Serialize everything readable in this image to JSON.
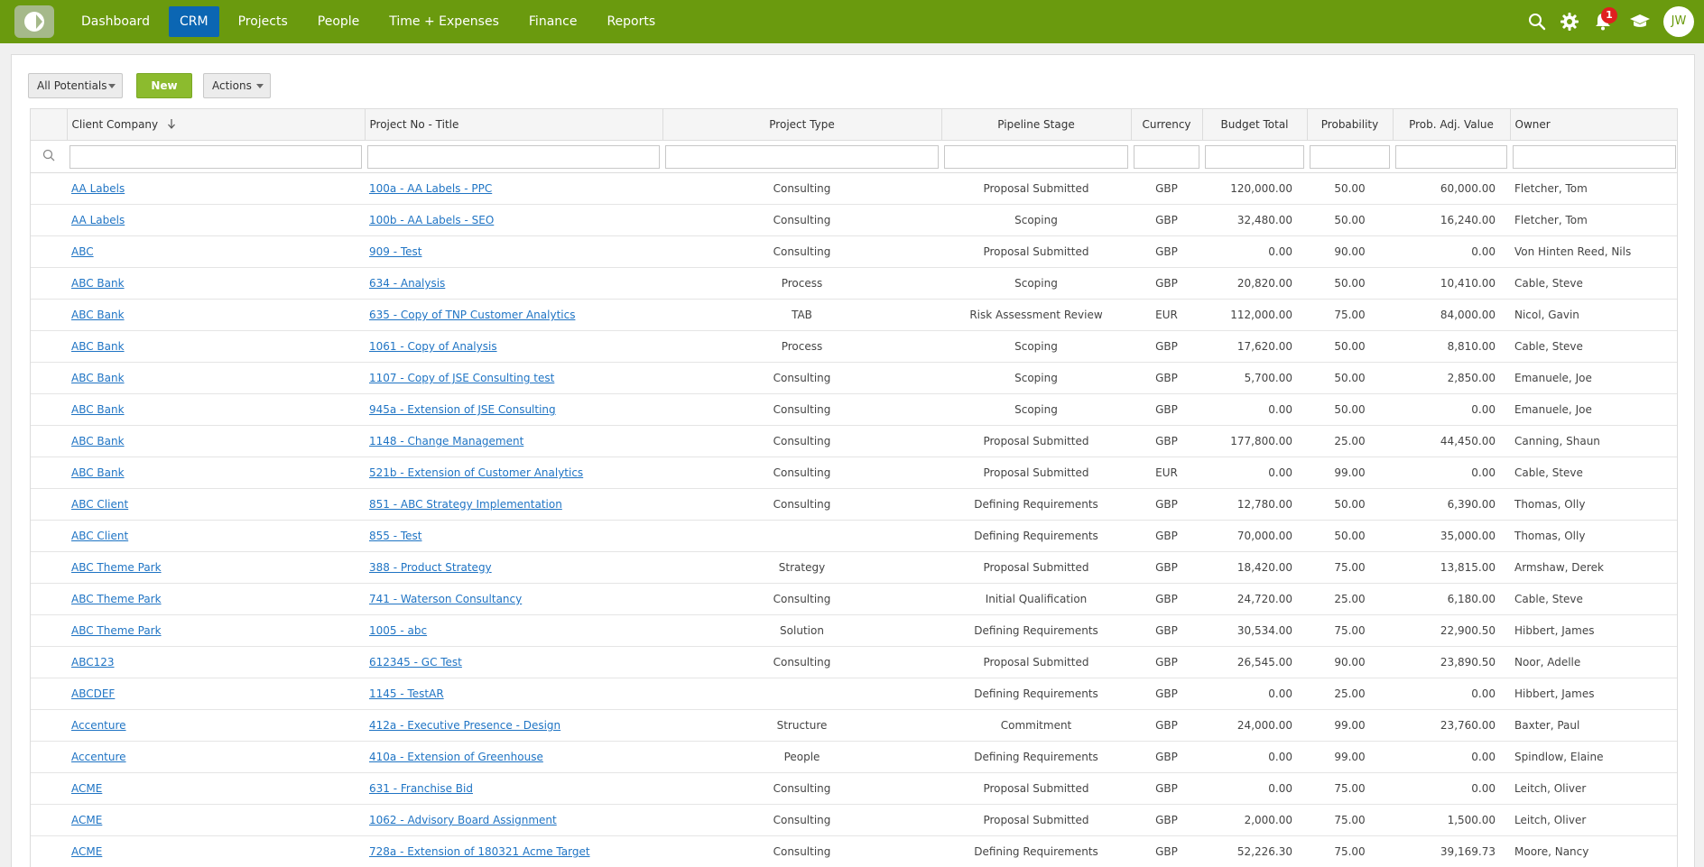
{
  "nav": {
    "items": [
      "Dashboard",
      "CRM",
      "Projects",
      "People",
      "Time + Expenses",
      "Finance",
      "Reports"
    ],
    "active": "CRM",
    "notification_count": "1",
    "avatar_initials": "JW",
    "brand_color": "#6a9a0e",
    "active_color": "#0b66b3"
  },
  "toolbar": {
    "filter_label": "All Potentials",
    "new_label": "New",
    "actions_label": "Actions"
  },
  "table": {
    "columns": [
      "Client Company",
      "Project No - Title",
      "Project Type",
      "Pipeline Stage",
      "Currency",
      "Budget Total",
      "Probability",
      "Prob. Adj. Value",
      "Owner"
    ],
    "rows": [
      [
        "AA Labels",
        "100a - AA Labels - PPC",
        "Consulting",
        "Proposal Submitted",
        "GBP",
        "120,000.00",
        "50.00",
        "60,000.00",
        "Fletcher, Tom"
      ],
      [
        "AA Labels",
        "100b - AA Labels - SEO",
        "Consulting",
        "Scoping",
        "GBP",
        "32,480.00",
        "50.00",
        "16,240.00",
        "Fletcher, Tom"
      ],
      [
        "ABC",
        "909 - Test",
        "Consulting",
        "Proposal Submitted",
        "GBP",
        "0.00",
        "90.00",
        "0.00",
        "Von Hinten Reed, Nils"
      ],
      [
        "ABC Bank",
        "634 - Analysis",
        "Process",
        "Scoping",
        "GBP",
        "20,820.00",
        "50.00",
        "10,410.00",
        "Cable, Steve"
      ],
      [
        "ABC Bank",
        "635 - Copy of TNP Customer Analytics",
        "TAB",
        "Risk Assessment Review",
        "EUR",
        "112,000.00",
        "75.00",
        "84,000.00",
        "Nicol, Gavin"
      ],
      [
        "ABC Bank",
        "1061 - Copy of Analysis",
        "Process",
        "Scoping",
        "GBP",
        "17,620.00",
        "50.00",
        "8,810.00",
        "Cable, Steve"
      ],
      [
        "ABC Bank",
        "1107 - Copy of JSE Consulting test",
        "Consulting",
        "Scoping",
        "GBP",
        "5,700.00",
        "50.00",
        "2,850.00",
        "Emanuele, Joe"
      ],
      [
        "ABC Bank",
        "945a - Extension of JSE Consulting",
        "Consulting",
        "Scoping",
        "GBP",
        "0.00",
        "50.00",
        "0.00",
        "Emanuele, Joe"
      ],
      [
        "ABC Bank",
        "1148 - Change Management",
        "Consulting",
        "Proposal Submitted",
        "GBP",
        "177,800.00",
        "25.00",
        "44,450.00",
        "Canning, Shaun"
      ],
      [
        "ABC Bank",
        "521b - Extension of Customer Analytics",
        "Consulting",
        "Proposal Submitted",
        "EUR",
        "0.00",
        "99.00",
        "0.00",
        "Cable, Steve"
      ],
      [
        "ABC Client",
        "851 - ABC Strategy Implementation",
        "Consulting",
        "Defining Requirements",
        "GBP",
        "12,780.00",
        "50.00",
        "6,390.00",
        "Thomas, Olly"
      ],
      [
        "ABC Client",
        "855 - Test",
        "",
        "Defining Requirements",
        "GBP",
        "70,000.00",
        "50.00",
        "35,000.00",
        "Thomas, Olly"
      ],
      [
        "ABC Theme Park",
        "388 - Product Strategy",
        "Strategy",
        "Proposal Submitted",
        "GBP",
        "18,420.00",
        "75.00",
        "13,815.00",
        "Armshaw, Derek"
      ],
      [
        "ABC Theme Park",
        "741 - Waterson Consultancy",
        "Consulting",
        "Initial Qualification",
        "GBP",
        "24,720.00",
        "25.00",
        "6,180.00",
        "Cable, Steve"
      ],
      [
        "ABC Theme Park",
        "1005 - abc",
        "Solution",
        "Defining Requirements",
        "GBP",
        "30,534.00",
        "75.00",
        "22,900.50",
        "Hibbert, James"
      ],
      [
        "ABC123",
        "612345 - GC Test",
        "Consulting",
        "Proposal Submitted",
        "GBP",
        "26,545.00",
        "90.00",
        "23,890.50",
        "Noor, Adelle"
      ],
      [
        "ABCDEF",
        "1145 - TestAR",
        "",
        "Defining Requirements",
        "GBP",
        "0.00",
        "25.00",
        "0.00",
        "Hibbert, James"
      ],
      [
        "Accenture",
        "412a - Executive Presence - Design",
        "Structure",
        "Commitment",
        "GBP",
        "24,000.00",
        "99.00",
        "23,760.00",
        "Baxter, Paul"
      ],
      [
        "Accenture",
        "410a - Extension of Greenhouse",
        "People",
        "Defining Requirements",
        "GBP",
        "0.00",
        "99.00",
        "0.00",
        "Spindlow, Elaine"
      ],
      [
        "ACME",
        "631 - Franchise Bid",
        "Consulting",
        "Proposal Submitted",
        "GBP",
        "0.00",
        "75.00",
        "0.00",
        "Leitch, Oliver"
      ],
      [
        "ACME",
        "1062 - Advisory Board Assignment",
        "Consulting",
        "Proposal Submitted",
        "GBP",
        "2,000.00",
        "75.00",
        "1,500.00",
        "Leitch, Oliver"
      ],
      [
        "ACME",
        "728a - Extension of 180321 Acme Target",
        "Consulting",
        "Defining Requirements",
        "GBP",
        "52,226.30",
        "75.00",
        "39,169.73",
        "Moore, Nancy"
      ]
    ]
  }
}
